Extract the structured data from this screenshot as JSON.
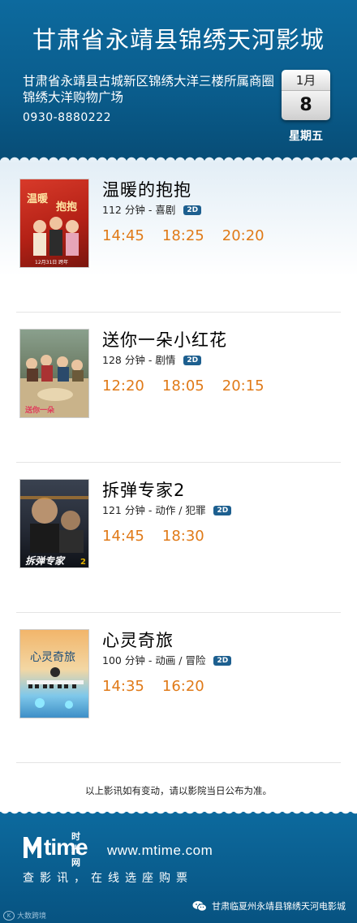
{
  "header": {
    "cinema_name": "甘肃省永靖县锦绣天河影城",
    "address": "甘肃省永靖县古城新区锦绣大洋三楼所属商圈锦绣大洋购物广场",
    "phone": "0930-8880222",
    "date": {
      "month": "1月",
      "day": "8",
      "weekday": "星期五"
    }
  },
  "movies": [
    {
      "title": "温暖的抱抱",
      "duration": "112 分钟",
      "genre": "喜剧",
      "format": "2D",
      "showtimes": [
        "14:45",
        "18:25",
        "20:20"
      ],
      "poster_text": "温暖的抱抱"
    },
    {
      "title": "送你一朵小红花",
      "duration": "128 分钟",
      "genre": "剧情",
      "format": "2D",
      "showtimes": [
        "12:20",
        "18:05",
        "20:15"
      ],
      "poster_text": "送你一朵小红花"
    },
    {
      "title": "拆弹专家2",
      "duration": "121 分钟",
      "genre": "动作 / 犯罪",
      "format": "2D",
      "showtimes": [
        "14:45",
        "18:30"
      ],
      "poster_text": "拆弹专家2"
    },
    {
      "title": "心灵奇旅",
      "duration": "100 分钟",
      "genre": "动画 / 冒险",
      "format": "2D",
      "showtimes": [
        "14:35",
        "16:20"
      ],
      "poster_text": "心灵奇旅"
    }
  ],
  "notice": "以上影讯如有变动，请以影院当日公布为准。",
  "footer": {
    "logo_text": "time",
    "logo_cn": "时光网",
    "site": "www.mtime.com",
    "tagline": "查影讯，在线选座购票",
    "wechat_account": "甘肃临夏州永靖县锦绣天河电影城",
    "corner_label": "大数跨境"
  },
  "colors": {
    "header_blue": "#0a5d8d",
    "showtime_orange": "#e07a18",
    "badge_blue": "#1d5f8f"
  }
}
